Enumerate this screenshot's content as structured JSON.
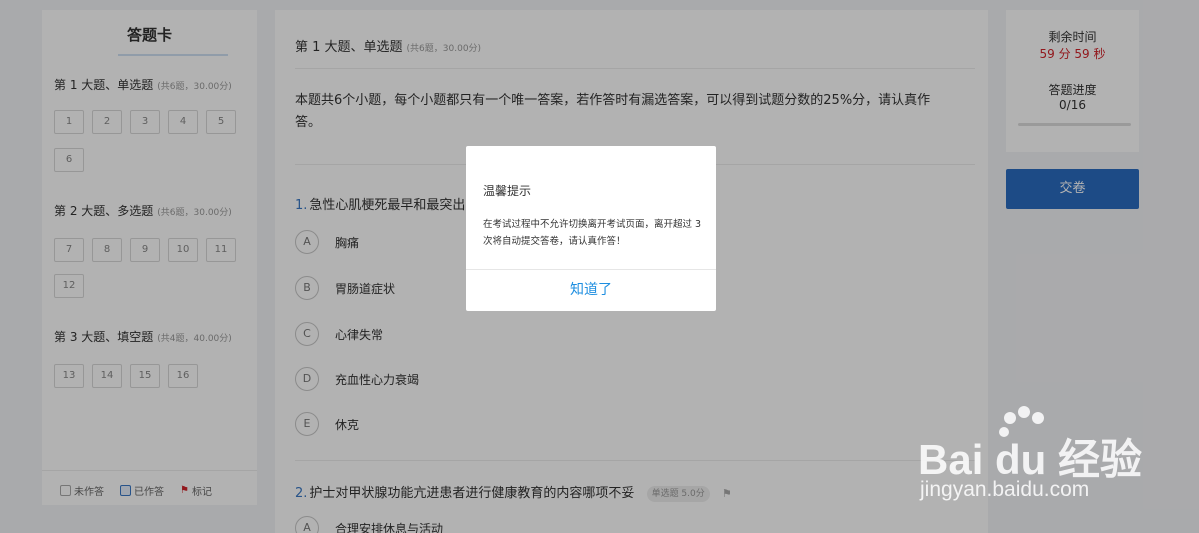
{
  "answer_card": {
    "title": "答题卡",
    "sections": [
      {
        "title": "第 1 大题、单选题",
        "meta": "(共6题，30.00分)",
        "questions": [
          "1",
          "2",
          "3",
          "4",
          "5",
          "6"
        ]
      },
      {
        "title": "第 2 大题、多选题",
        "meta": "(共6题，30.00分)",
        "questions": [
          "7",
          "8",
          "9",
          "10",
          "11",
          "12"
        ]
      },
      {
        "title": "第 3 大题、填空题",
        "meta": "(共4题，40.00分)",
        "questions": [
          "13",
          "14",
          "15",
          "16"
        ]
      }
    ],
    "legend": {
      "unanswered": "未作答",
      "answered": "已作答",
      "flagged": "标记"
    }
  },
  "main": {
    "section_title": "第 1 大题、单选题",
    "section_meta": "(共6题，30.00分)",
    "intro": "本题共6个小题，每个小题都只有一个唯一答案，若作答时有漏选答案，可以得到试题分数的25%分，请认真作答。",
    "q1": {
      "number": "1.",
      "text": "急性心肌梗死最早和最突出",
      "options": [
        {
          "letter": "A",
          "text": "胸痛"
        },
        {
          "letter": "B",
          "text": "胃肠道症状"
        },
        {
          "letter": "C",
          "text": "心律失常"
        },
        {
          "letter": "D",
          "text": "充血性心力衰竭"
        },
        {
          "letter": "E",
          "text": "休克"
        }
      ]
    },
    "q2": {
      "number": "2.",
      "text": "护士对甲状腺功能亢进患者进行健康教育的内容哪项不妥",
      "tag": "单选题 5.0分",
      "first_option": {
        "letter": "A",
        "text": "合理安排休息与活动"
      }
    }
  },
  "status": {
    "remaining_label": "剩余时间",
    "remaining_time": "59 分 59 秒",
    "progress_label": "答题进度",
    "progress_value": "0/16",
    "progress_fraction": 0
  },
  "submit_label": "交卷",
  "dialog": {
    "title": "温馨提示",
    "message": "在考试过程中不允许切换离开考试页面，离开超过 3 次将自动提交答卷，请认真作答！",
    "button": "知道了"
  },
  "watermark": {
    "brand": "Bai du 经验",
    "url": "jingyan.baidu.com"
  }
}
